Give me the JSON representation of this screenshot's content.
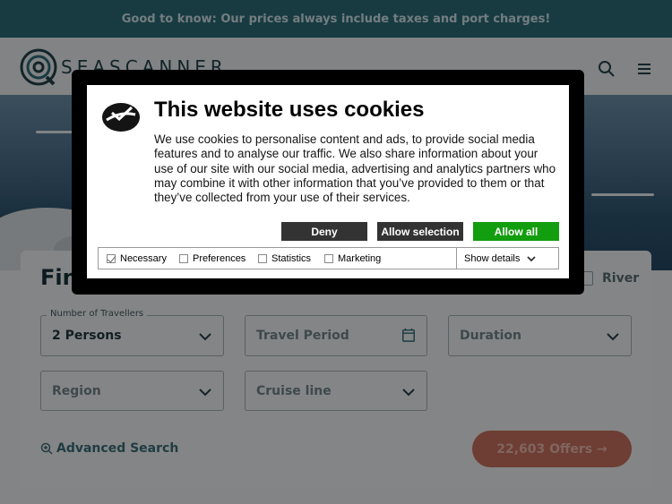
{
  "banner": {
    "text": "Good to know: Our prices always include taxes and port charges!"
  },
  "header": {
    "logo_text": "SEASCANNER",
    "icons": [
      "search-icon",
      "menu-icon"
    ]
  },
  "search": {
    "title": "Fin",
    "river_label": "River",
    "travellers_label": "Number of Travellers",
    "travellers_value": "2 Persons",
    "travel_period_placeholder": "Travel Period",
    "duration_placeholder": "Duration",
    "region_placeholder": "Region",
    "cruise_line_placeholder": "Cruise line",
    "advanced_search": "Advanced Search",
    "offers_button": "22,603 Offers →"
  },
  "cookie_dialog": {
    "title": "This website uses cookies",
    "body": "We use cookies to personalise content and ads, to provide social media features and to analyse our traffic. We also share information about your use of our site with our social media, advertising and analytics partners who may combine it with other information that you’ve provided to them or that they’ve collected from your use of their services.",
    "buttons": {
      "deny": "Deny",
      "allow_selection": "Allow selection",
      "allow_all": "Allow all"
    },
    "preferences": [
      {
        "label": "Necessary",
        "checked": true
      },
      {
        "label": "Preferences",
        "checked": false
      },
      {
        "label": "Statistics",
        "checked": false
      },
      {
        "label": "Marketing",
        "checked": false
      }
    ],
    "show_details": "Show details"
  },
  "colors": {
    "banner": "#2c6c79",
    "accent": "#c8705e",
    "allow_all": "#129e0e",
    "deny": "#333333"
  }
}
